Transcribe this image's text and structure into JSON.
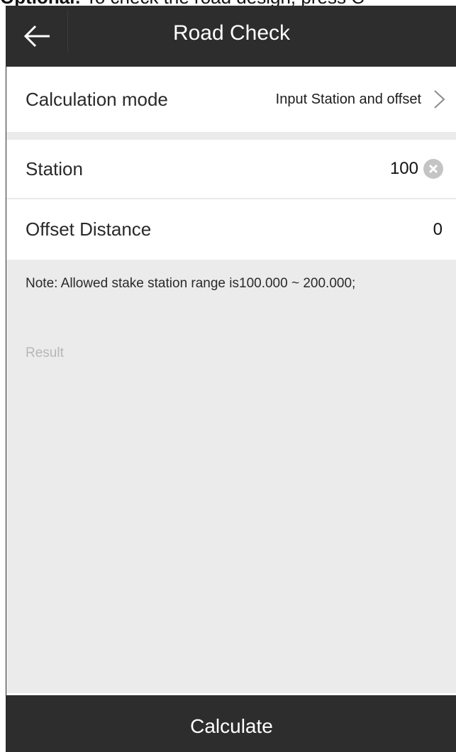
{
  "caption": {
    "bold": "Optional:",
    "text": " To check the road design, press C"
  },
  "header": {
    "title": "Road Check",
    "back_icon": "arrow-left-icon"
  },
  "form": {
    "calculation_mode": {
      "label": "Calculation mode",
      "value": "Input Station and offset",
      "icon": "chevron-right-icon"
    },
    "station": {
      "label": "Station",
      "value": "100",
      "icon": "clear-icon"
    },
    "offset": {
      "label": "Offset Distance",
      "value": "0"
    }
  },
  "note": "Note: Allowed stake station range is100.000 ~ 200.000;",
  "result_label": "Result",
  "calculate_button": "Calculate",
  "colors": {
    "bar": "#2d2d2d",
    "background": "#ebebeb",
    "row": "#ffffff",
    "muted_text": "#b7b7b7"
  }
}
